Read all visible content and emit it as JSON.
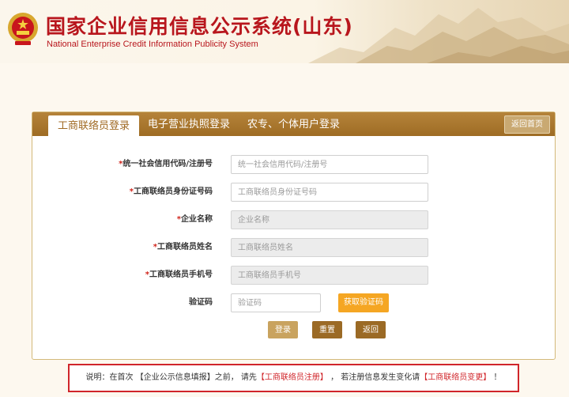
{
  "header": {
    "title": "国家企业信用信息公示系统(山东)",
    "subtitle": "National Enterprise Credit Information Publicity System"
  },
  "tabs": [
    {
      "label": "工商联络员登录",
      "active": true
    },
    {
      "label": "电子营业执照登录",
      "active": false
    },
    {
      "label": "农专、个体用户登录",
      "active": false
    }
  ],
  "back_home_label": "返回首页",
  "form": {
    "credit_code": {
      "label": "统一社会信用代码/注册号",
      "placeholder": "统一社会信用代码/注册号",
      "required": true
    },
    "id_number": {
      "label": "工商联络员身份证号码",
      "placeholder": "工商联络员身份证号码",
      "required": true
    },
    "company_name": {
      "label": "企业名称",
      "placeholder": "企业名称",
      "required": true,
      "readonly": true
    },
    "liaison_name": {
      "label": "工商联络员姓名",
      "placeholder": "工商联络员姓名",
      "required": true,
      "readonly": true
    },
    "liaison_phone": {
      "label": "工商联络员手机号",
      "placeholder": "工商联络员手机号",
      "required": true,
      "readonly": true
    },
    "captcha": {
      "label": "验证码",
      "placeholder": "验证码",
      "button_label": "获取验证码"
    },
    "required_mark": "*"
  },
  "actions": {
    "login": "登录",
    "reset": "重置",
    "back": "返回"
  },
  "notice": {
    "prefix": "说明：在首次 【企业公示信息填报】之前， 请先",
    "link_register": "【工商联络员注册】",
    "middle": " ， 若注册信息发生变化请",
    "link_change": "【工商联络员变更】",
    "suffix": " ！"
  },
  "colors": {
    "brand_red": "#b8161d",
    "tab_bar": "#a8762e",
    "captcha_button": "#f5a623",
    "login_button": "#c9a35f",
    "reset_button": "#9b6a25",
    "notice_border": "#d0252a"
  }
}
